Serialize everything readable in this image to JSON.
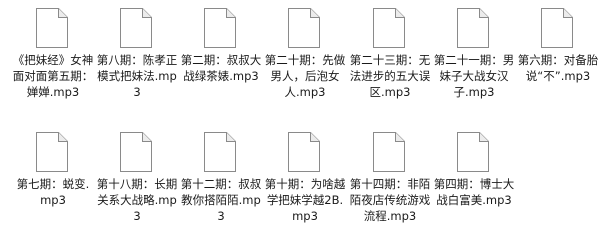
{
  "files": [
    {
      "name": "《把妹经》女神面对面第五期：婵婵.mp3",
      "icon": "generic-file-icon"
    },
    {
      "name": "第八期：陈孝正模式把妹法.mp3",
      "icon": "generic-file-icon"
    },
    {
      "name": "第二期：叔叔大战绿茶婊.mp3",
      "icon": "generic-file-icon"
    },
    {
      "name": "第二十期：先做男人，后泡女人.mp3",
      "icon": "generic-file-icon"
    },
    {
      "name": "第二十三期：无法进步的五大误区.mp3",
      "icon": "generic-file-icon"
    },
    {
      "name": "第二十一期：男妹子大战女汉子.mp3",
      "icon": "generic-file-icon"
    },
    {
      "name": "第六期：对备胎说“不”.mp3",
      "icon": "generic-file-icon"
    },
    {
      "name": "第七期：蜕变.mp3",
      "icon": "generic-file-icon"
    },
    {
      "name": "第十八期：长期关系大战略.mp3",
      "icon": "generic-file-icon"
    },
    {
      "name": "第十二期：叔叔教你搭陌陌.mp3",
      "icon": "generic-file-icon"
    },
    {
      "name": "第十期：为啥越学把妹学越2B.mp3",
      "icon": "generic-file-icon"
    },
    {
      "name": "第十四期：非陌陌夜店传统游戏流程.mp3",
      "icon": "generic-file-icon"
    },
    {
      "name": "第四期：博士大战白富美.mp3",
      "icon": "generic-file-icon"
    }
  ]
}
